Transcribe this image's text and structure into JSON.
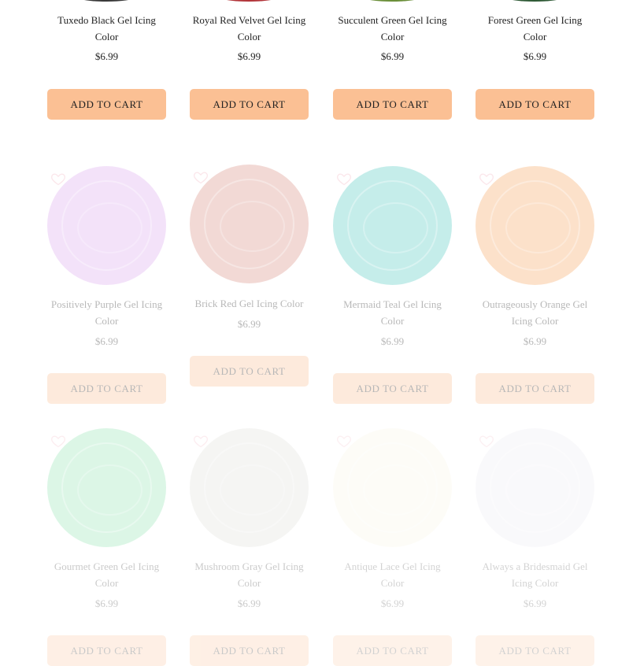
{
  "rows": [
    {
      "items": [
        {
          "name": "Tuxedo Black Gel Icing Color",
          "price": "$6.99",
          "button": "ADD TO CART",
          "swatch": "#3a3a3a"
        },
        {
          "name": "Royal Red Velvet Gel Icing Color",
          "price": "$6.99",
          "button": "ADD TO CART",
          "swatch": "#b2353a"
        },
        {
          "name": "Succulent Green Gel Icing Color",
          "price": "$6.99",
          "button": "ADD TO CART",
          "swatch": "#6b8f3a"
        },
        {
          "name": "Forest Green Gel Icing Color",
          "price": "$6.99",
          "button": "ADD TO CART",
          "swatch": "#2f5a36"
        }
      ]
    },
    {
      "items": [
        {
          "name": "Positively Purple Gel Icing Color",
          "price": "$6.99",
          "button": "ADD TO CART",
          "swatch": "#dca6ef"
        },
        {
          "name": "Brick Red Gel Icing Color",
          "price": "$6.99",
          "button": "ADD TO CART",
          "swatch": "#d98a7f"
        },
        {
          "name": "Mermaid Teal Gel Icing Color",
          "price": "$6.99",
          "button": "ADD TO CART",
          "swatch": "#4fc8c1"
        },
        {
          "name": "Outrageously Orange Gel Icing Color",
          "price": "$6.99",
          "button": "ADD TO CART",
          "swatch": "#f7a35c"
        }
      ]
    },
    {
      "items": [
        {
          "name": "Gourmet Green Gel Icing Color",
          "price": "$6.99",
          "button": "ADD TO CART",
          "swatch": "#6fdc9a"
        },
        {
          "name": "Mushroom Gray Gel Icing Color",
          "price": "$6.99",
          "button": "ADD TO CART",
          "swatch": "#d6d6d0"
        },
        {
          "name": "Antique Lace Gel Icing Color",
          "price": "$6.99",
          "button": "ADD TO CART",
          "swatch": "#f6f4dc"
        },
        {
          "name": "Always a Bridesmaid Gel Icing Color",
          "price": "$6.99",
          "button": "ADD TO CART",
          "swatch": "#e6e2ee"
        }
      ]
    }
  ],
  "colors": {
    "button_bg": "#fbc094",
    "text": "#222222"
  },
  "icons": {
    "wishlist": "heart-outline-icon"
  }
}
